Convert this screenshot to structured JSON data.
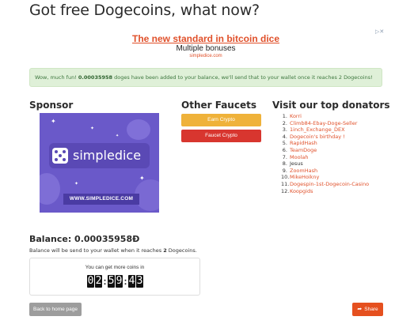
{
  "page": {
    "title": "Got free Dogecoins, what now?"
  },
  "ad": {
    "headline": "The new standard in bitcoin dice",
    "subline": "Multiple bonuses",
    "url": "simpledice.com",
    "adchoices_icon": "adchoices-icon"
  },
  "alert": {
    "prefix": "Wow, much fun! ",
    "amount": "0.00035958",
    "suffix": " doges have been added to your balance, we'll send that to your wallet once it reaches 2 Dogecoins!"
  },
  "sponsor": {
    "heading": "Sponsor",
    "banner_name": "simpledice",
    "banner_url": "WWW.SIMPLEDICE.COM"
  },
  "faucets": {
    "heading": "Other Faucets",
    "buttons": [
      {
        "label": "Earn Crypto",
        "color": "#efb23a"
      },
      {
        "label": "Faucet Crypto",
        "color": "#d8362f"
      }
    ]
  },
  "donators": {
    "heading": "Visit our top donators",
    "items": [
      {
        "num": "1.",
        "name": "Korri"
      },
      {
        "num": "2.",
        "name": "Climb84-Ebay-Doge-Seller"
      },
      {
        "num": "3.",
        "name": "1inch_Exchange_DEX"
      },
      {
        "num": "4.",
        "name": "Dogecoin's birthday !"
      },
      {
        "num": "5.",
        "name": "RapidHash"
      },
      {
        "num": "6.",
        "name": "TeamDoge"
      },
      {
        "num": "7.",
        "name": "Moolah"
      },
      {
        "num": "8.",
        "name": "Jesus"
      },
      {
        "num": "9.",
        "name": "ZoomHash"
      },
      {
        "num": "10.",
        "name": "MikeHoikny"
      },
      {
        "num": "11.",
        "name": "Dogespin-1st-Dogecoin-Casino"
      },
      {
        "num": "12.",
        "name": "Koopgids"
      }
    ]
  },
  "balance": {
    "title": "Balance: 0.00035958Đ",
    "note_prefix": "Balance will be send to your wallet when it reaches ",
    "note_amount": "2",
    "note_suffix": " Dogecoins."
  },
  "timer": {
    "label": "You can get more coins in",
    "digits": [
      "0",
      "2",
      ":",
      "5",
      "9",
      ":",
      "4",
      "3"
    ]
  },
  "footer": {
    "home_label": "Back to home page",
    "share_label": "Share",
    "share_icon": "share-icon"
  },
  "colors": {
    "accent": "#e0502a",
    "alert_bg": "#dff0d8",
    "alert_text": "#3c763d",
    "sponsor_bg": "#6a59c9"
  }
}
